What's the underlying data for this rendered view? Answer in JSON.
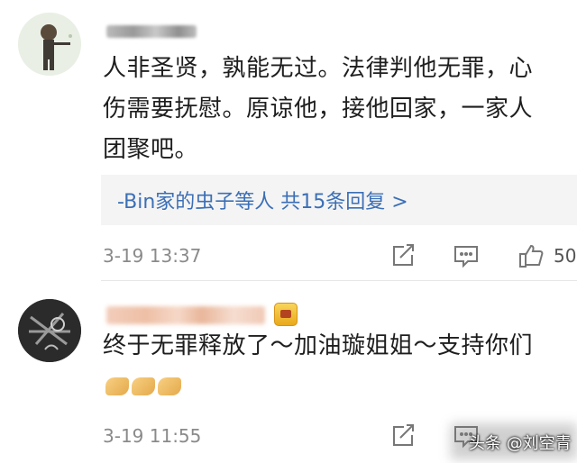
{
  "comments": [
    {
      "text": "人非圣贤，孰能无过。法律判他无罪，心伤需要抚慰。原谅他，接他回家，一家人团聚吧。",
      "replies": "-Bin家的虫子等人 共15条回复 >",
      "time": "3-19 13:37",
      "likes": "50",
      "icons": [
        "share-icon",
        "comment-icon",
        "like-icon"
      ]
    },
    {
      "text": "终于无罪释放了～加油璇姐姐～支持你们",
      "time": "3-19 11:55",
      "icons": [
        "share-icon",
        "comment-icon",
        "flexed-biceps-emoji",
        "vip-badge-icon"
      ]
    }
  ],
  "watermark": "头条 @刘空青"
}
